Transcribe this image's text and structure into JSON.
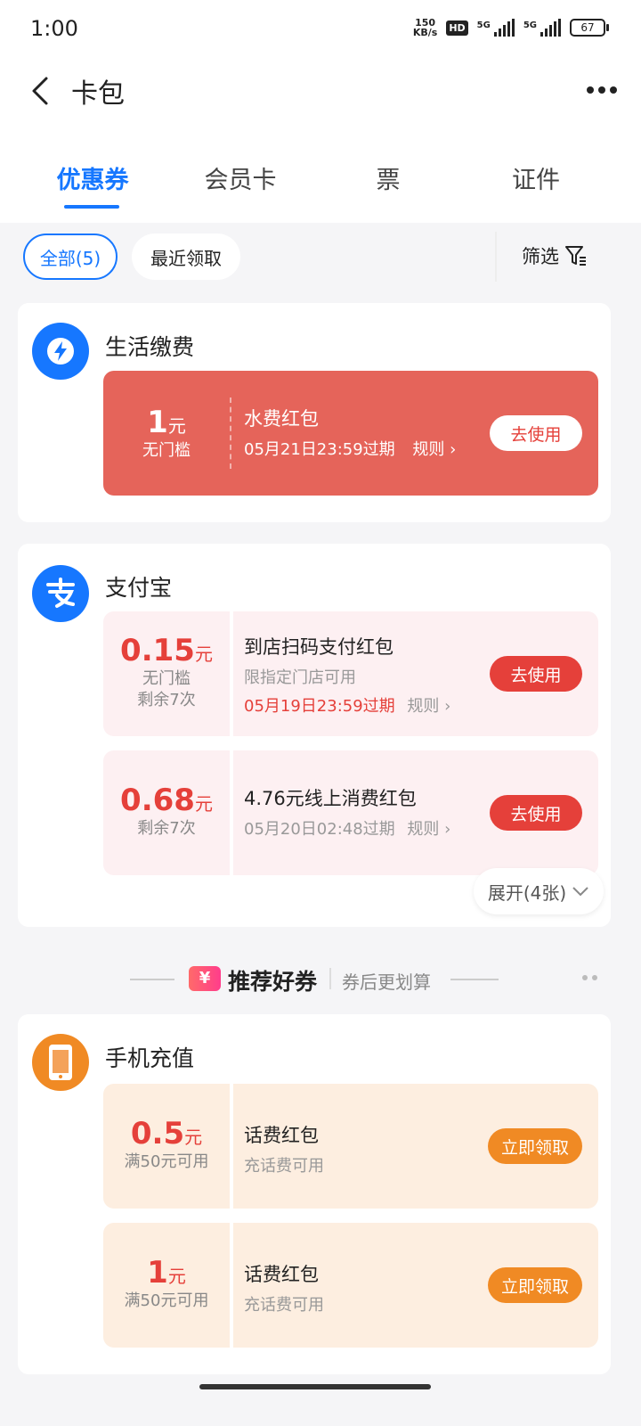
{
  "status": {
    "time": "1:00",
    "speed_value": "150",
    "speed_unit": "KB/s",
    "hd": "HD",
    "battery": "67",
    "net1": "5G",
    "net2": "5G"
  },
  "nav": {
    "title": "卡包"
  },
  "tabs": [
    {
      "label": "优惠券"
    },
    {
      "label": "会员卡"
    },
    {
      "label": "票"
    },
    {
      "label": "证件"
    }
  ],
  "filters": {
    "all": "全部(5)",
    "recent": "最近领取",
    "filter": "筛选"
  },
  "sections": [
    {
      "title": "生活缴费",
      "coupons": [
        {
          "amount": "1",
          "unit": "元",
          "sub1": "无门槛",
          "title": "水费红包",
          "expire": "05月21日23:59过期",
          "rules": "规则",
          "button": "去使用"
        }
      ]
    },
    {
      "title": "支付宝",
      "coupons": [
        {
          "amount": "0.15",
          "unit": "元",
          "sub1": "无门槛",
          "sub2": "剩余7次",
          "title": "到店扫码支付红包",
          "desc": "限指定门店可用",
          "expire": "05月19日23:59过期",
          "rules": "规则",
          "button": "去使用"
        },
        {
          "amount": "0.68",
          "unit": "元",
          "sub1": "剩余7次",
          "title": "4.76元线上消费红包",
          "expire": "05月20日02:48过期",
          "rules": "规则",
          "button": "去使用"
        }
      ],
      "expand": "展开(4张)"
    },
    {
      "title": "手机充值",
      "coupons": [
        {
          "amount": "0.5",
          "unit": "元",
          "sub1": "满50元可用",
          "title": "话费红包",
          "desc": "充话费可用",
          "button": "立即领取"
        },
        {
          "amount": "1",
          "unit": "元",
          "sub1": "满50元可用",
          "title": "话费红包",
          "desc": "充话费可用",
          "button": "立即领取"
        }
      ]
    }
  ],
  "recommend": {
    "badge": "¥",
    "title": "推荐好券",
    "subtitle": "券后更划算"
  },
  "colors": {
    "accent": "#1677ff",
    "red": "#e5403a",
    "active_coupon": "#e5645a",
    "orange": "#f08a24"
  }
}
